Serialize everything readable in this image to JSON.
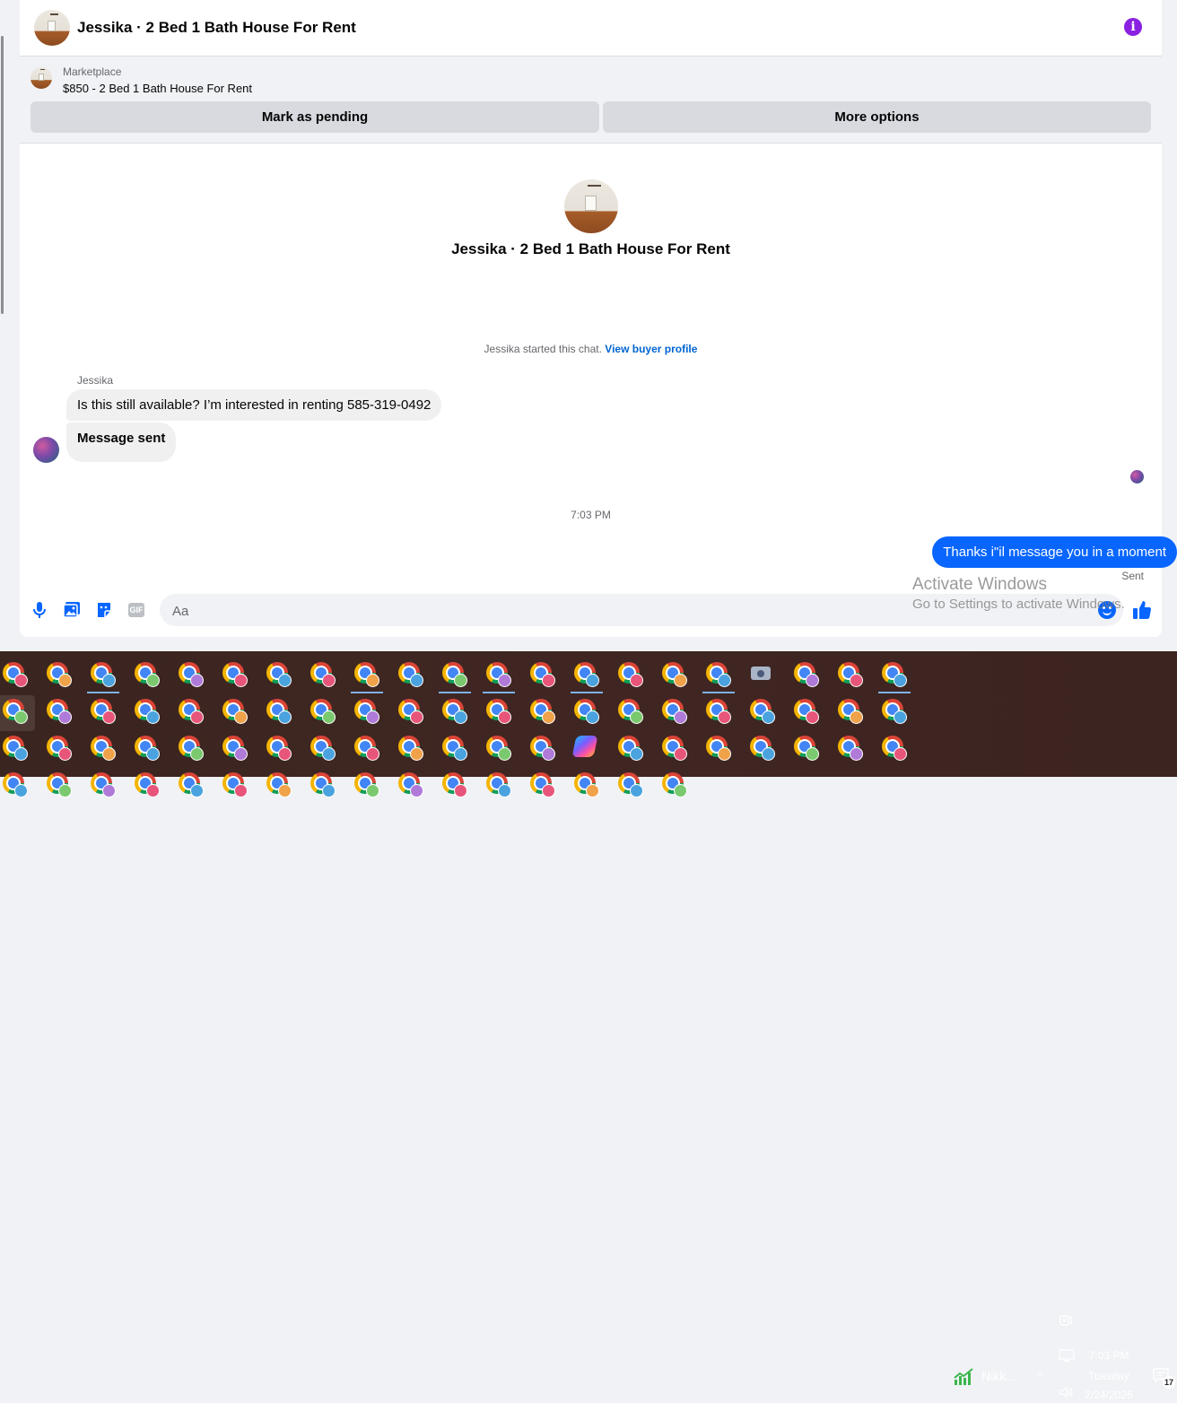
{
  "conversation": {
    "title": "Jessika · 2 Bed 1 Bath House For Rent",
    "info_icon": "info-icon",
    "info_glyph": "i"
  },
  "marketplace": {
    "label": "Marketplace",
    "listing": "$850 - 2 Bed 1 Bath House For Rent",
    "mark_pending_label": "Mark as pending",
    "more_options_label": "More options"
  },
  "chat": {
    "intro_title": "Jessika · 2 Bed 1 Bath House For Rent",
    "started_text": "Jessika started this chat.",
    "view_buyer_profile": "View buyer profile",
    "sender_name": "Jessika",
    "incoming": [
      "Is this still available? I’m interested in renting 585-319-0492",
      "Message sent"
    ],
    "timestamp": "7:03 PM",
    "outgoing": "Thanks i\"il message you in a moment",
    "sent_status": "Sent"
  },
  "composer": {
    "placeholder": "Aa",
    "gif_label": "GIF",
    "icons": [
      "microphone-icon",
      "photo-icon",
      "sticker-icon",
      "gif-icon",
      "emoji-icon",
      "like-icon"
    ]
  },
  "watermark": {
    "line1": "Activate Windows",
    "line2": "Go to Settings to activate Windows."
  },
  "taskbar": {
    "stock_label": "Nikk...",
    "chevron": "^",
    "time": "7:03 PM",
    "day": "Tuesday",
    "date": "2/24/2026",
    "notification_count": "17"
  },
  "colors": {
    "accent": "#0866ff",
    "info": "#8a21e0",
    "link": "#0064d1",
    "taskbar_bg": "#3e2520"
  }
}
